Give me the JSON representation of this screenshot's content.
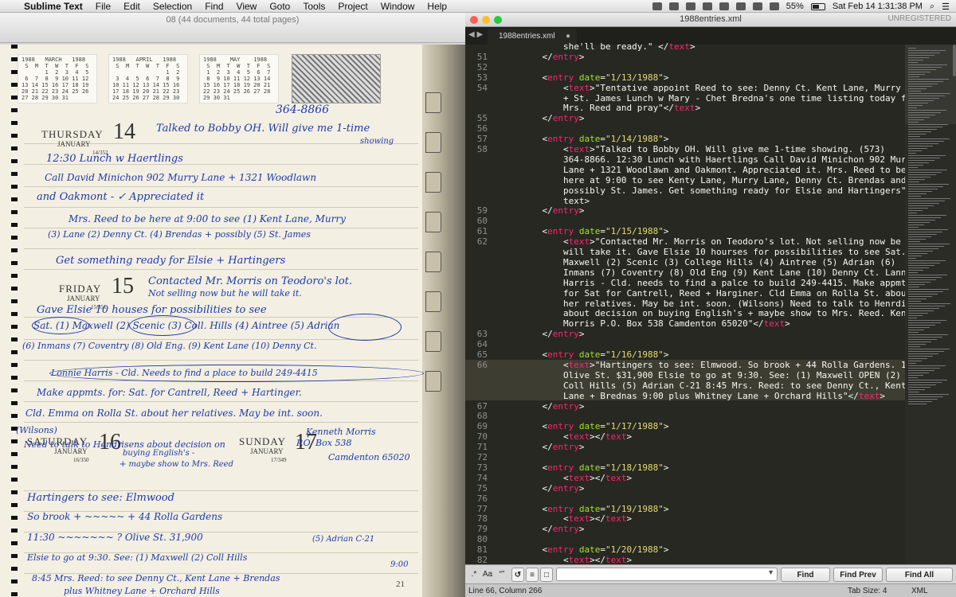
{
  "menubar": {
    "app_name": "Sublime Text",
    "items": [
      "File",
      "Edit",
      "Selection",
      "Find",
      "View",
      "Goto",
      "Tools",
      "Project",
      "Window",
      "Help"
    ],
    "battery": "55%",
    "battery_level": 0.55,
    "datetime": "Sat Feb 14  1:31:38 PM"
  },
  "preview": {
    "title": "08 (44 documents, 44 total pages)",
    "calendars": [
      {
        "header": "1988   MARCH   1988",
        "rows": [
          " S  M  T  W  T  F  S",
          "       1  2  3  4  5",
          " 6  7  8  9 10 11 12",
          "13 14 15 16 17 18 19",
          "20 21 22 23 24 25 26",
          "27 28 29 30 31"
        ]
      },
      {
        "header": "1988   APRIL   1988",
        "rows": [
          " S  M  T  W  T  F  S",
          "                1  2",
          " 3  4  5  6  7  8  9",
          "10 11 12 13 14 15 16",
          "17 18 19 20 21 22 23",
          "24 25 26 27 28 29 30"
        ]
      },
      {
        "header": "1988    MAY    1988",
        "rows": [
          " S  M  T  W  T  F  S",
          " 1  2  3  4  5  6  7",
          " 8  9 10 11 12 13 14",
          "15 16 17 18 19 20 21",
          "22 23 24 25 26 27 28",
          "29 30 31"
        ]
      }
    ],
    "days": [
      {
        "name": "THURSDAY",
        "month": "JANUARY",
        "num": "14",
        "sub": "14/352"
      },
      {
        "name": "FRIDAY",
        "month": "JANUARY",
        "num": "15",
        "sub": "15/351"
      },
      {
        "name": "SATURDAY",
        "month": "JANUARY",
        "num": "16",
        "sub": "16/350"
      },
      {
        "name": "SUNDAY",
        "month": "JANUARY",
        "num": "17",
        "sub": "17/349"
      }
    ],
    "page_number": "21",
    "handwriting": [
      "364-8866",
      "Talked to Bobby OH. Will give me 1-time",
      "showing",
      "12:30 Lunch w Haertlings",
      "Call David Minichon 902 Murry Lane + 1321 Woodlawn",
      "and Oakmont - ✓   Appreciated it",
      "Mrs. Reed to be here at 9:00 to see (1) Kent Lane, Murry",
      "(3) Lane (2) Denny Ct. (4) Brendas + possibly (5) St. James",
      "Get something ready for Elsie + Hartingers",
      "Contacted Mr. Morris on Teodoro's lot.",
      "Not selling now but he will take it.",
      "Gave Elsie 10 houses for possibilities to see",
      "Sat. (1) Maxwell (2) Scenic (3) Coll. Hills (4) Aintree (5) Adrian",
      "(6) Inmans (7) Coventry (8) Old Eng. (9) Kent Lane (10) Denny Ct.",
      "Lonnie Harris - Cld. Needs to find a place to build 249-4415",
      "Make appmts. for: Sat. for Cantrell, Reed + Hartinger.",
      "Cld. Emma on Rolla St. about her relatives. May be int. soon.",
      "(Wilsons)",
      "Need to talk to Hendrisens about decision on",
      "buying English's -",
      "+ maybe show to Mrs. Reed",
      "Kenneth Morris",
      "P.O. Box 538",
      "Camdenton 65020",
      "Hartingers to see: Elmwood",
      "So brook + ~~~~~ + 44 Rolla Gardens",
      "11:30  ~~~~~~~ ? Olive St. 31,900",
      "Elsie to go at 9:30. See: (1) Maxwell (2) Coll Hills",
      "(5) Adrian C-21",
      "8:45 Mrs. Reed: to see Denny Ct., Kent Lane + Brendas",
      "9:00",
      "plus Whitney Lane + Orchard Hills"
    ]
  },
  "sublime": {
    "window_title": "1988entries.xml",
    "unregistered": "UNREGISTERED",
    "tab_label": "1988entries.xml",
    "tab_dot": "●",
    "nav_arrows": "◀ ▶",
    "status": {
      "position": "Line 66, Column 266",
      "tab_size": "Tab Size: 4",
      "syntax": "XML"
    },
    "find": {
      "find_label": "Find",
      "find_prev_label": "Find Prev",
      "find_all_label": "Find All",
      "input_value": "",
      "options": [
        "Aa",
        "“”"
      ]
    },
    "colors": {
      "tag": "#f92672",
      "attr": "#a6e22e",
      "string": "#e6db74",
      "text": "#f8f8f2",
      "background": "#272822"
    },
    "lines": [
      {
        "n": "",
        "code": "        she'll be ready.\" </text>"
      },
      {
        "n": "51",
        "code": "    </entry>"
      },
      {
        "n": "52",
        "code": ""
      },
      {
        "n": "53",
        "code": "    <entry date=\"1/13/1988\">"
      },
      {
        "n": "54",
        "code": "        <text>\"Tentative appoint Reed to see: Denny Ct. Kent Lane, Murry Lane"
      },
      {
        "n": "",
        "code": "        + St. James Lunch w Mary - Chet Bredna's one time listing today for"
      },
      {
        "n": "",
        "code": "        Mrs. Reed and pray\"</text>"
      },
      {
        "n": "55",
        "code": "    </entry>"
      },
      {
        "n": "56",
        "code": ""
      },
      {
        "n": "57",
        "code": "    <entry date=\"1/14/1988\">"
      },
      {
        "n": "58",
        "code": "        <text>\"Talked to Bobby OH. Will give me 1-time showing. (573)"
      },
      {
        "n": "",
        "code": "        364-8866. 12:30 Lunch with Haertlings Call David Minichon 902 Murry"
      },
      {
        "n": "",
        "code": "        Lane + 1321 Woodlawn and Oakmont. Appreciated it. Mrs. Reed to be"
      },
      {
        "n": "",
        "code": "        here at 9:00 to see Kenty Lane, Murry Lane, Denny Ct. Brendas and"
      },
      {
        "n": "",
        "code": "        possibly St. James. Get something ready for Elsie and Hartingers\"</"
      },
      {
        "n": "",
        "code": "        text>"
      },
      {
        "n": "59",
        "code": "    </entry>"
      },
      {
        "n": "60",
        "code": ""
      },
      {
        "n": "61",
        "code": "    <entry date=\"1/15/1988\">"
      },
      {
        "n": "62",
        "code": "        <text>\"Contacted Mr. Morris on Teodoro's lot. Not selling now be he"
      },
      {
        "n": "",
        "code": "        will take it. Gave Elsie 10 hourses for possibilities to see Sat. (1)"
      },
      {
        "n": "",
        "code": "        Maxwell (2) Scenic (3) College Hills (4) Aintree (5) Adrian (6)"
      },
      {
        "n": "",
        "code": "        Inmans (7) Coventry (8) Old Eng (9) Kent Lane (10) Denny Ct. Lannie"
      },
      {
        "n": "",
        "code": "        Harris - Cld. needs to find a palce to build 249-4415. Make appmts"
      },
      {
        "n": "",
        "code": "        for Sat for Cantrell, Reed + Harginer. Cld Emma on Rolla St. about"
      },
      {
        "n": "",
        "code": "        her relatives. May be int. soon. (Wilsons) Need to talk to Henrdisens"
      },
      {
        "n": "",
        "code": "        about decision on buying English's + maybe show to Mrs. Reed. Kenneth"
      },
      {
        "n": "",
        "code": "        Morris P.O. Box 538 Camdenton 65020\"</text>"
      },
      {
        "n": "63",
        "code": "    </entry>"
      },
      {
        "n": "64",
        "code": ""
      },
      {
        "n": "65",
        "code": "    <entry date=\"1/16/1988\">"
      },
      {
        "n": "66",
        "code": "        <text>\"Hartingers to see: Elmwood. So brook + 44 Rolla Gardens. 11:30",
        "current": true
      },
      {
        "n": "",
        "code": "        Olive St. $31,900 Elsie to go at 9:30. See: (1) Maxwell OPEN (2) S.",
        "current": true
      },
      {
        "n": "",
        "code": "        Coll Hills (5) Adrian C-21 8:45 Mrs. Reed: to see Denny Ct., Kent",
        "current": true
      },
      {
        "n": "",
        "code": "        Lane + Brednas 9:00 plus Whitney Lane + Orchard Hills\"</text>",
        "current": true
      },
      {
        "n": "67",
        "code": "    </entry>"
      },
      {
        "n": "68",
        "code": ""
      },
      {
        "n": "69",
        "code": "    <entry date=\"1/17/1988\">"
      },
      {
        "n": "70",
        "code": "        <text></text>"
      },
      {
        "n": "71",
        "code": "    </entry>"
      },
      {
        "n": "72",
        "code": ""
      },
      {
        "n": "73",
        "code": "    <entry date=\"1/18/1988\">"
      },
      {
        "n": "74",
        "code": "        <text></text>"
      },
      {
        "n": "75",
        "code": "    </entry>"
      },
      {
        "n": "76",
        "code": ""
      },
      {
        "n": "77",
        "code": "    <entry date=\"1/19/1988\">"
      },
      {
        "n": "78",
        "code": "        <text></text>"
      },
      {
        "n": "79",
        "code": "    </entry>"
      },
      {
        "n": "80",
        "code": ""
      },
      {
        "n": "81",
        "code": "    <entry date=\"1/20/1988\">"
      },
      {
        "n": "82",
        "code": "        <text></text>"
      }
    ]
  }
}
